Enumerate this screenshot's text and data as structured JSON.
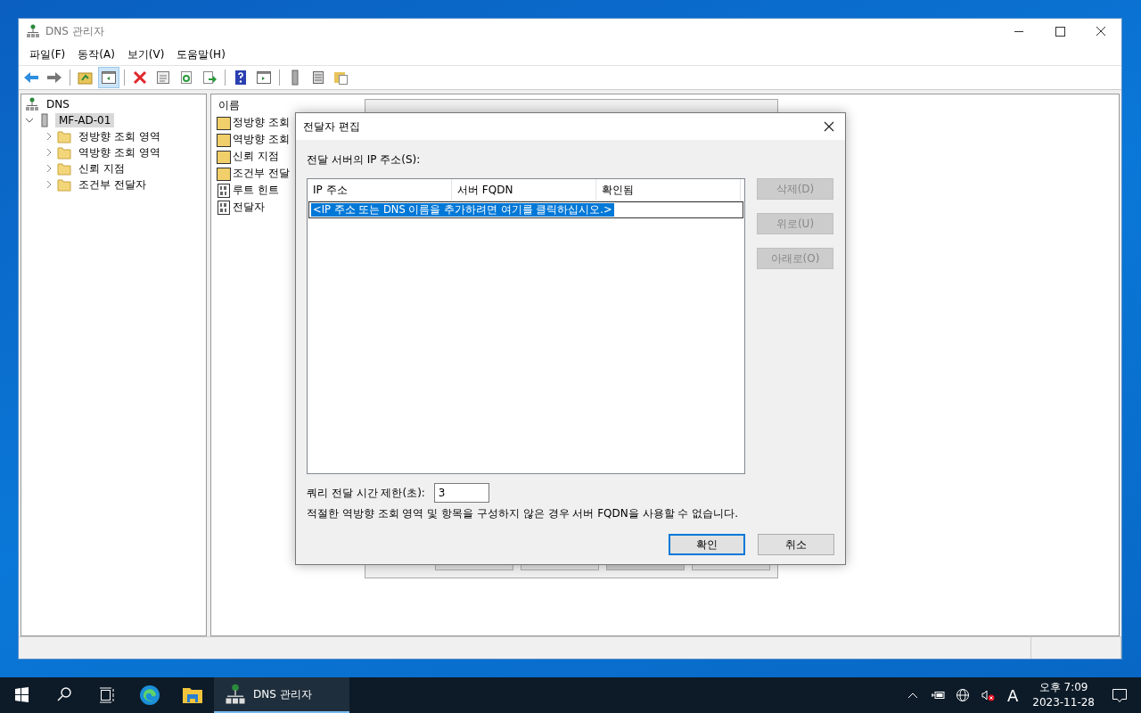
{
  "window": {
    "title": "DNS 관리자"
  },
  "menu": [
    {
      "label": "파일(F)"
    },
    {
      "label": "동작(A)"
    },
    {
      "label": "보기(V)"
    },
    {
      "label": "도움말(H)"
    }
  ],
  "tree": {
    "label": "DNS",
    "children": [
      {
        "label": "MF-AD-01",
        "selected": true,
        "expanded": true,
        "children": [
          {
            "label": "정방향 조회 영역",
            "expanded": false
          },
          {
            "label": "역방향 조회 영역",
            "expanded": false
          },
          {
            "label": "신뢰 지점",
            "expanded": false
          },
          {
            "label": "조건부 전달자",
            "expanded": false
          }
        ]
      }
    ]
  },
  "list": {
    "column": "이름",
    "items": [
      {
        "label": "정방향 조회",
        "kind": "folder"
      },
      {
        "label": "역방향 조회",
        "kind": "folder"
      },
      {
        "label": "신뢰 지점",
        "kind": "folder"
      },
      {
        "label": "조건부 전달",
        "kind": "folder"
      },
      {
        "label": "루트 힌트",
        "kind": "file"
      },
      {
        "label": "전달자",
        "kind": "file"
      }
    ]
  },
  "dialog": {
    "title": "전달자 편집",
    "list_label": "전달 서버의 IP 주소(S):",
    "columns": [
      "IP 주소",
      "서버 FQDN",
      "확인됨"
    ],
    "rows": [
      {
        "text": "<IP 주소 또는 DNS 이름을 추가하려면 여기를 클릭하십시오.>",
        "selected": true
      }
    ],
    "side_buttons": [
      {
        "label": "삭제(D)",
        "disabled": true
      },
      {
        "label": "위로(U)",
        "disabled": true
      },
      {
        "label": "아래로(O)",
        "disabled": true
      }
    ],
    "timeout_label": "쿼리 전달 시간 제한(초):",
    "timeout_value": "3",
    "note": "적절한 역방향 조회 영역 및 항목을 구성하지 않은 경우 서버 FQDN을 사용할 수 없습니다.",
    "buttons": [
      {
        "label": "확인",
        "default": true
      },
      {
        "label": "취소",
        "default": false
      }
    ]
  },
  "taskbar": {
    "apps": [
      {
        "kind": "edge",
        "selected": false
      },
      {
        "kind": "explorer",
        "selected": false
      },
      {
        "kind": "dns",
        "label": "DNS 관리자",
        "selected": true
      }
    ],
    "ime": "A",
    "time": "오후 7:09",
    "date": "2023-11-28"
  }
}
